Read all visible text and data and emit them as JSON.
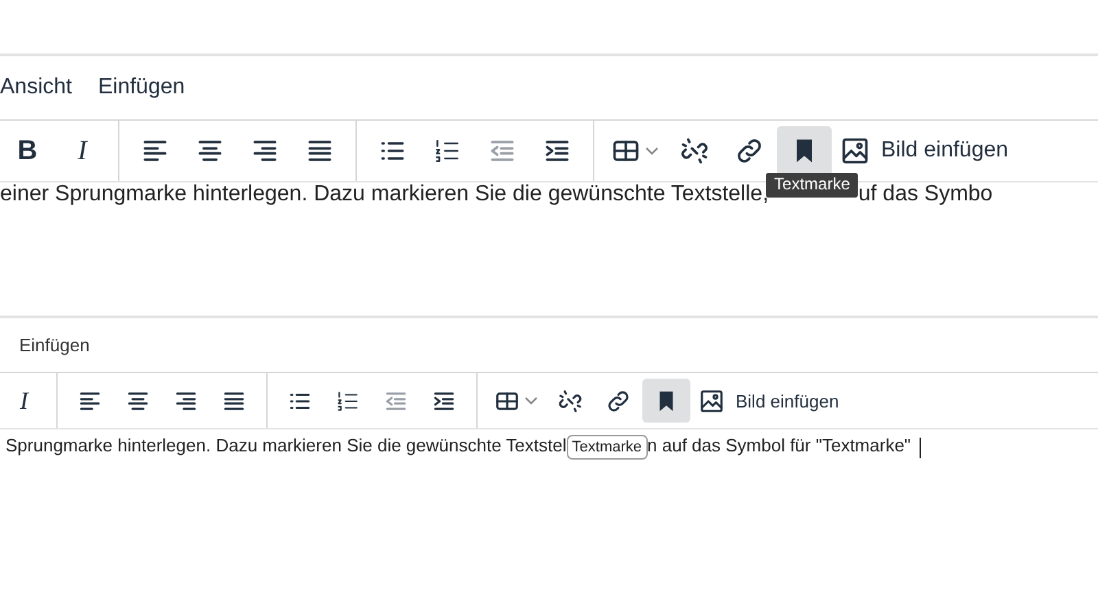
{
  "editors": [
    {
      "kind": "large",
      "menu": [
        {
          "label": "Ansicht"
        },
        {
          "label": "Einfügen"
        }
      ],
      "toolbar": [
        {
          "kind": "bold",
          "glyph": "B",
          "active": false,
          "disabled": false
        },
        {
          "kind": "italic",
          "glyph": "I",
          "active": false,
          "disabled": false
        },
        {
          "kind": "separator"
        },
        {
          "kind": "align-left",
          "active": false,
          "disabled": false
        },
        {
          "kind": "align-center",
          "active": false,
          "disabled": false
        },
        {
          "kind": "align-right",
          "active": false,
          "disabled": false
        },
        {
          "kind": "justify",
          "active": false,
          "disabled": false
        },
        {
          "kind": "separator"
        },
        {
          "kind": "bullet-list",
          "active": false,
          "disabled": false
        },
        {
          "kind": "numbered-list",
          "active": false,
          "disabled": false
        },
        {
          "kind": "outdent",
          "active": false,
          "disabled": true
        },
        {
          "kind": "indent",
          "active": false,
          "disabled": false
        },
        {
          "kind": "separator"
        },
        {
          "kind": "table",
          "active": false,
          "disabled": false
        },
        {
          "kind": "unlink",
          "active": false,
          "disabled": false
        },
        {
          "kind": "link",
          "active": false,
          "disabled": false
        },
        {
          "kind": "bookmark",
          "active": true,
          "disabled": false
        },
        {
          "kind": "image",
          "label": "Bild einfügen",
          "active": false,
          "disabled": false
        }
      ],
      "text_before": "einer Sprungmarke hinterlegen. Dazu markieren Sie die gewünschte Textstelle,",
      "text_after": "uf das Symbo",
      "caret": false,
      "tooltip": {
        "text": "Textmarke",
        "kind": "dark"
      }
    },
    {
      "kind": "small",
      "menu": [
        {
          "label": "Einfügen"
        }
      ],
      "toolbar": [
        {
          "kind": "italic",
          "glyph": "I",
          "active": false,
          "disabled": false
        },
        {
          "kind": "separator"
        },
        {
          "kind": "align-left",
          "active": false,
          "disabled": false
        },
        {
          "kind": "align-center",
          "active": false,
          "disabled": false
        },
        {
          "kind": "align-right",
          "active": false,
          "disabled": false
        },
        {
          "kind": "justify",
          "active": false,
          "disabled": false
        },
        {
          "kind": "separator"
        },
        {
          "kind": "bullet-list",
          "active": false,
          "disabled": false
        },
        {
          "kind": "numbered-list",
          "active": false,
          "disabled": false
        },
        {
          "kind": "outdent",
          "active": false,
          "disabled": true
        },
        {
          "kind": "indent",
          "active": false,
          "disabled": false
        },
        {
          "kind": "separator"
        },
        {
          "kind": "table",
          "active": false,
          "disabled": false
        },
        {
          "kind": "unlink",
          "active": false,
          "disabled": false
        },
        {
          "kind": "link",
          "active": false,
          "disabled": false
        },
        {
          "kind": "bookmark",
          "active": true,
          "disabled": false
        },
        {
          "kind": "image",
          "label": "Bild einfügen",
          "active": false,
          "disabled": false
        }
      ],
      "text_before": "Sprungmarke hinterlegen. Dazu markieren Sie die gewünschte Textstel",
      "text_after": "n auf das Symbol für \"Textmarke\"",
      "caret": true,
      "tooltip": {
        "text": "Textmarke",
        "kind": "light"
      }
    }
  ]
}
